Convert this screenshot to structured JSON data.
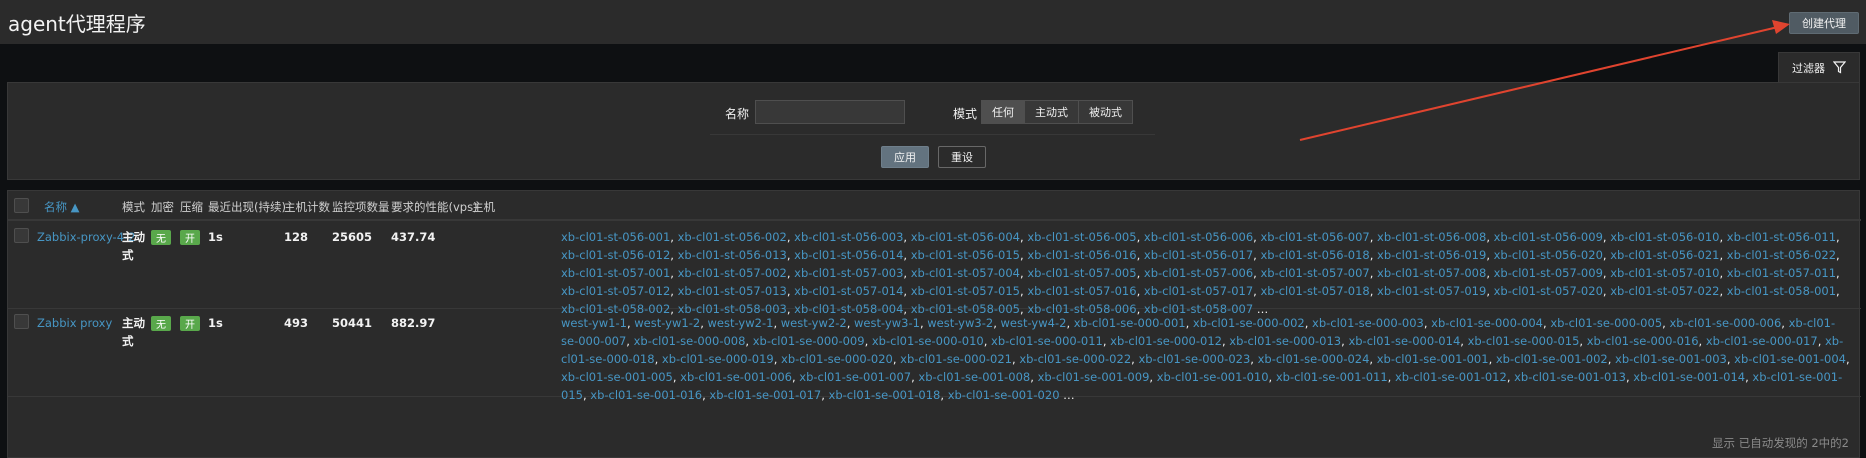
{
  "header": {
    "title": "agent代理程序",
    "create_button": "创建代理"
  },
  "filter": {
    "tab_label": "过滤器",
    "name_label": "名称",
    "name_value": "",
    "mode_label": "模式",
    "mode_options": [
      "任何",
      "主动式",
      "被动式"
    ],
    "mode_selected": "任何",
    "apply_label": "应用",
    "reset_label": "重设"
  },
  "table": {
    "columns": {
      "name": "名称",
      "mode": "模式",
      "encryption": "加密",
      "compression": "压缩",
      "last_seen": "最近出现(持续)",
      "host_count": "主机计数",
      "item_count": "监控项数量",
      "required_performance": "要求的性能(vps)",
      "hosts": "主机"
    },
    "rows": [
      {
        "name": "Zabbix-proxy-4-2",
        "mode": "主动式",
        "encryption": "无",
        "compression": "开",
        "last_seen": "1s",
        "host_count": "128",
        "item_count": "25605",
        "required_performance": "437.74",
        "hosts": [
          "xb-cl01-st-056-001",
          "xb-cl01-st-056-002",
          "xb-cl01-st-056-003",
          "xb-cl01-st-056-004",
          "xb-cl01-st-056-005",
          "xb-cl01-st-056-006",
          "xb-cl01-st-056-007",
          "xb-cl01-st-056-008",
          "xb-cl01-st-056-009",
          "xb-cl01-st-056-010",
          "xb-cl01-st-056-011",
          "xb-cl01-st-056-012",
          "xb-cl01-st-056-013",
          "xb-cl01-st-056-014",
          "xb-cl01-st-056-015",
          "xb-cl01-st-056-016",
          "xb-cl01-st-056-017",
          "xb-cl01-st-056-018",
          "xb-cl01-st-056-019",
          "xb-cl01-st-056-020",
          "xb-cl01-st-056-021",
          "xb-cl01-st-056-022",
          "xb-cl01-st-057-001",
          "xb-cl01-st-057-002",
          "xb-cl01-st-057-003",
          "xb-cl01-st-057-004",
          "xb-cl01-st-057-005",
          "xb-cl01-st-057-006",
          "xb-cl01-st-057-007",
          "xb-cl01-st-057-008",
          "xb-cl01-st-057-009",
          "xb-cl01-st-057-010",
          "xb-cl01-st-057-011",
          "xb-cl01-st-057-012",
          "xb-cl01-st-057-013",
          "xb-cl01-st-057-014",
          "xb-cl01-st-057-015",
          "xb-cl01-st-057-016",
          "xb-cl01-st-057-017",
          "xb-cl01-st-057-018",
          "xb-cl01-st-057-019",
          "xb-cl01-st-057-020",
          "xb-cl01-st-057-022",
          "xb-cl01-st-058-001",
          "xb-cl01-st-058-002",
          "xb-cl01-st-058-003",
          "xb-cl01-st-058-004",
          "xb-cl01-st-058-005",
          "xb-cl01-st-058-006",
          "xb-cl01-st-058-007"
        ]
      },
      {
        "name": "Zabbix proxy",
        "mode": "主动式",
        "encryption": "无",
        "compression": "开",
        "last_seen": "1s",
        "host_count": "493",
        "item_count": "50441",
        "required_performance": "882.97",
        "hosts": [
          "west-yw1-1",
          "west-yw1-2",
          "west-yw2-1",
          "west-yw2-2",
          "west-yw3-1",
          "west-yw3-2",
          "west-yw4-2",
          "xb-cl01-se-000-001",
          "xb-cl01-se-000-002",
          "xb-cl01-se-000-003",
          "xb-cl01-se-000-004",
          "xb-cl01-se-000-005",
          "xb-cl01-se-000-006",
          "xb-cl01-se-000-007",
          "xb-cl01-se-000-008",
          "xb-cl01-se-000-009",
          "xb-cl01-se-000-010",
          "xb-cl01-se-000-011",
          "xb-cl01-se-000-012",
          "xb-cl01-se-000-013",
          "xb-cl01-se-000-014",
          "xb-cl01-se-000-015",
          "xb-cl01-se-000-016",
          "xb-cl01-se-000-017",
          "xb-cl01-se-000-018",
          "xb-cl01-se-000-019",
          "xb-cl01-se-000-020",
          "xb-cl01-se-000-021",
          "xb-cl01-se-000-022",
          "xb-cl01-se-000-023",
          "xb-cl01-se-000-024",
          "xb-cl01-se-001-001",
          "xb-cl01-se-001-002",
          "xb-cl01-se-001-003",
          "xb-cl01-se-001-004",
          "xb-cl01-se-001-005",
          "xb-cl01-se-001-006",
          "xb-cl01-se-001-007",
          "xb-cl01-se-001-008",
          "xb-cl01-se-001-009",
          "xb-cl01-se-001-010",
          "xb-cl01-se-001-011",
          "xb-cl01-se-001-012",
          "xb-cl01-se-001-013",
          "xb-cl01-se-001-014",
          "xb-cl01-se-001-015",
          "xb-cl01-se-001-016",
          "xb-cl01-se-001-017",
          "xb-cl01-se-001-018",
          "xb-cl01-se-001-020"
        ]
      }
    ],
    "footer": "显示 已自动发现的 2中的2"
  },
  "colors": {
    "link": "#4796c4",
    "badge_green": "#59a84b",
    "annotation_arrow": "#e0442f"
  }
}
